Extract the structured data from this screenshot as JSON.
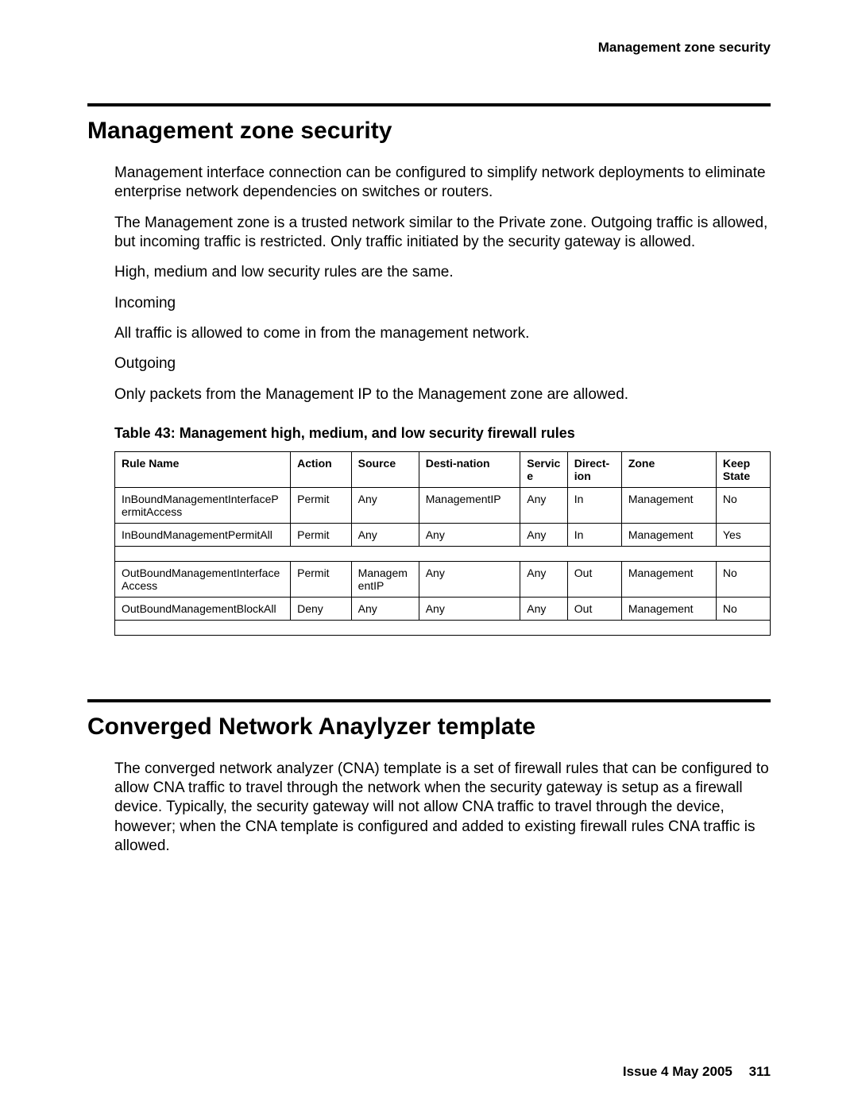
{
  "running_head": "Management zone security",
  "section1": {
    "title": "Management zone security",
    "paragraphs": [
      "Management interface connection can be configured to simplify network deployments to eliminate enterprise network dependencies on switches or routers.",
      "The Management zone is a trusted network similar to the Private zone. Outgoing traffic is allowed, but incoming traffic is restricted. Only traffic initiated by the security gateway is allowed.",
      "High, medium and low security rules are the same.",
      "Incoming",
      "All traffic is allowed to come in from the management network.",
      "Outgoing",
      "Only packets from the Management IP to the Management zone are allowed."
    ]
  },
  "table": {
    "caption": "Table 43: Management high, medium, and low security firewall rules",
    "headers": [
      "Rule Name",
      "Action",
      "Source",
      "Desti-nation",
      "Service",
      "Direct-ion",
      "Zone",
      "Keep State"
    ],
    "rows": [
      [
        "InBoundManagementInterfacePermitAccess",
        "Permit",
        "Any",
        "ManagementIP",
        "Any",
        "In",
        "Management",
        "No"
      ],
      [
        "InBoundManagementPermitAll",
        "Permit",
        "Any",
        "Any",
        "Any",
        "In",
        "Management",
        "Yes"
      ],
      "spacer",
      [
        "OutBoundManagementInterfaceAccess",
        "Permit",
        "ManagementIP",
        "Any",
        "Any",
        "Out",
        "Management",
        "No"
      ],
      [
        "OutBoundManagementBlockAll",
        "Deny",
        "Any",
        "Any",
        "Any",
        "Out",
        "Management",
        "No"
      ],
      "spacer"
    ]
  },
  "section2": {
    "title": "Converged Network Anaylyzer template",
    "paragraphs": [
      "The converged network analyzer (CNA) template is a set of firewall rules that can be configured to allow CNA traffic to travel through the network when the security gateway is setup as a firewall device. Typically, the security gateway will not allow CNA traffic to travel through the device, however; when the CNA template is configured and added to existing firewall rules CNA traffic is allowed."
    ]
  },
  "footer": {
    "issue": "Issue 4   May 2005",
    "page": "311"
  }
}
